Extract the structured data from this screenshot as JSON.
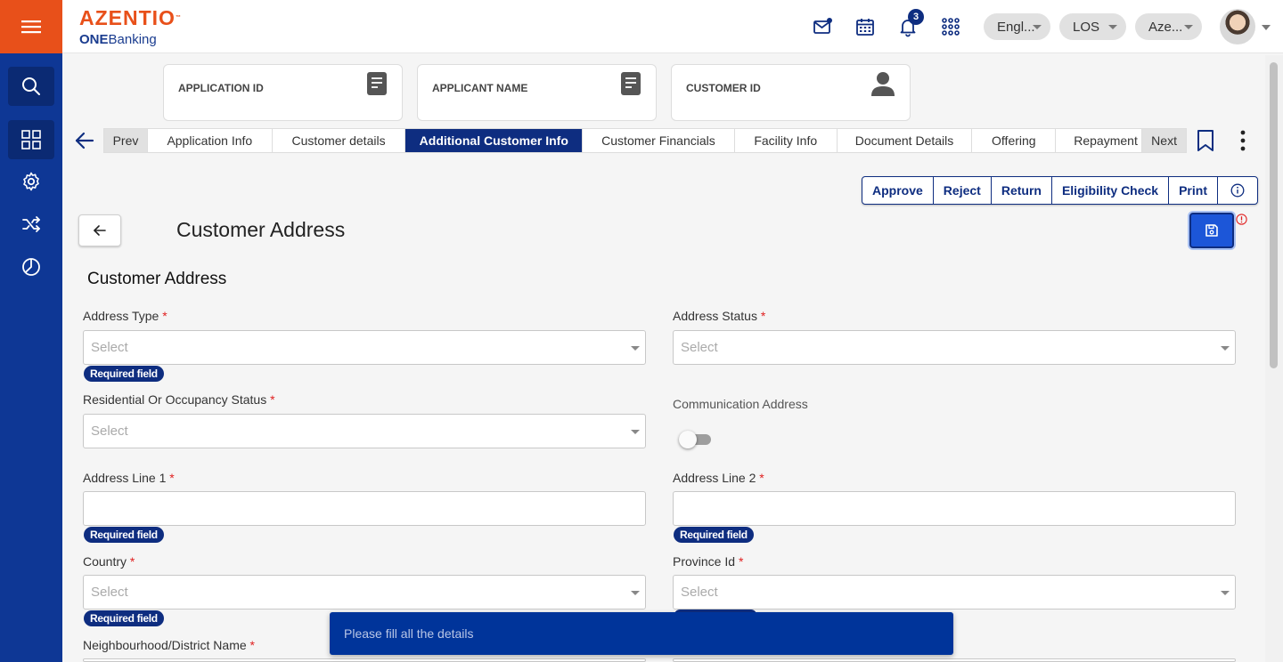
{
  "header": {
    "brand": "AZENTIO",
    "trademark": "™",
    "product_bold": "ONE",
    "product_rest": "Banking",
    "notification_count": "3",
    "language": "Engl...",
    "module": "LOS",
    "entity": "Aze..."
  },
  "cards": [
    {
      "label": "APPLICATION ID",
      "icon": "document-icon"
    },
    {
      "label": "APPLICANT NAME",
      "icon": "document-icon"
    },
    {
      "label": "CUSTOMER ID",
      "icon": "person-icon"
    }
  ],
  "tabs": {
    "prev": "Prev",
    "next": "Next",
    "items": [
      "Application Info",
      "Customer details",
      "Additional Customer Info",
      "Customer Financials",
      "Facility Info",
      "Document Details",
      "Offering",
      "Repayment S"
    ],
    "active_index": 2
  },
  "actions": {
    "approve": "Approve",
    "reject": "Reject",
    "return": "Return",
    "eligibility": "Eligibility Check",
    "print": "Print"
  },
  "page": {
    "title": "Customer Address",
    "section_title": "Customer Address"
  },
  "form": {
    "required_mark": "*",
    "required_badge": "Required field",
    "select_placeholder": "Select",
    "address_type": "Address Type",
    "address_status": "Address Status",
    "residential_status": "Residential Or Occupancy Status",
    "communication_address": "Communication Address",
    "address_line1": "Address Line 1",
    "address_line2": "Address Line 2",
    "country": "Country",
    "province": "Province Id",
    "neighbourhood": "Neighbourhood/District Name"
  },
  "toast": {
    "message": "Please fill all the details"
  },
  "colors": {
    "brand_orange": "#e8501a",
    "primary_navy": "#0e2d80",
    "sidebar": "#0e3795",
    "save_blue": "#1c56d8",
    "required_red": "#e02020"
  }
}
